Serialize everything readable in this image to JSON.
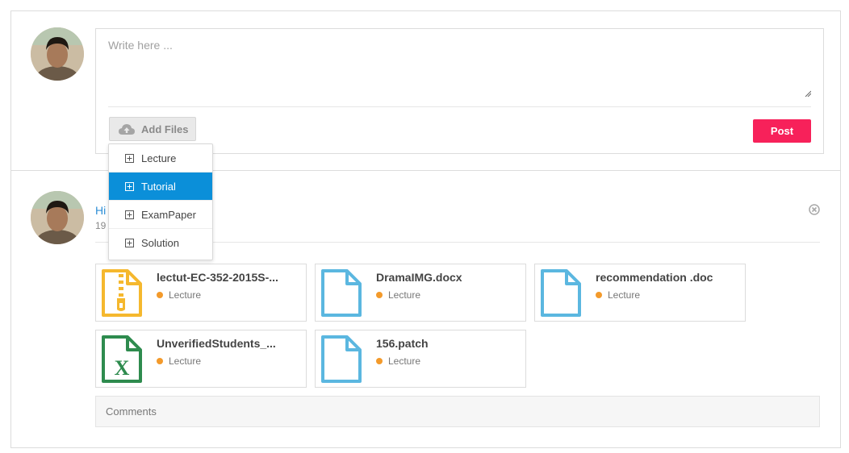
{
  "composer": {
    "placeholder": "Write here ...",
    "add_files_label": "Add Files",
    "post_label": "Post"
  },
  "dropdown": {
    "items": [
      {
        "label": "Lecture",
        "active": false
      },
      {
        "label": "Tutorial",
        "active": true
      },
      {
        "label": "ExamPaper",
        "active": false
      },
      {
        "label": "Solution",
        "active": false
      }
    ]
  },
  "post": {
    "author_visible": "Hi",
    "date_visible": "19",
    "files": [
      {
        "name": "lectut-EC-352-2015S-...",
        "tag": "Lecture",
        "icon": "zip-file-icon",
        "color": "#f5b82e"
      },
      {
        "name": "DramaIMG.docx",
        "tag": "Lecture",
        "icon": "document-file-icon",
        "color": "#5bb7e0"
      },
      {
        "name": "recommendation .doc",
        "tag": "Lecture",
        "icon": "document-file-icon",
        "color": "#5bb7e0"
      },
      {
        "name": "UnverifiedStudents_...",
        "tag": "Lecture",
        "icon": "excel-file-icon",
        "color": "#2e8b4e"
      },
      {
        "name": "156.patch",
        "tag": "Lecture",
        "icon": "document-file-icon",
        "color": "#5bb7e0"
      }
    ],
    "comments_label": "Comments"
  },
  "colors": {
    "accent": "#0b8fd9",
    "post_button": "#f7215a",
    "tag_dot": "#f39a2b",
    "author_link": "#2f8fd6"
  }
}
